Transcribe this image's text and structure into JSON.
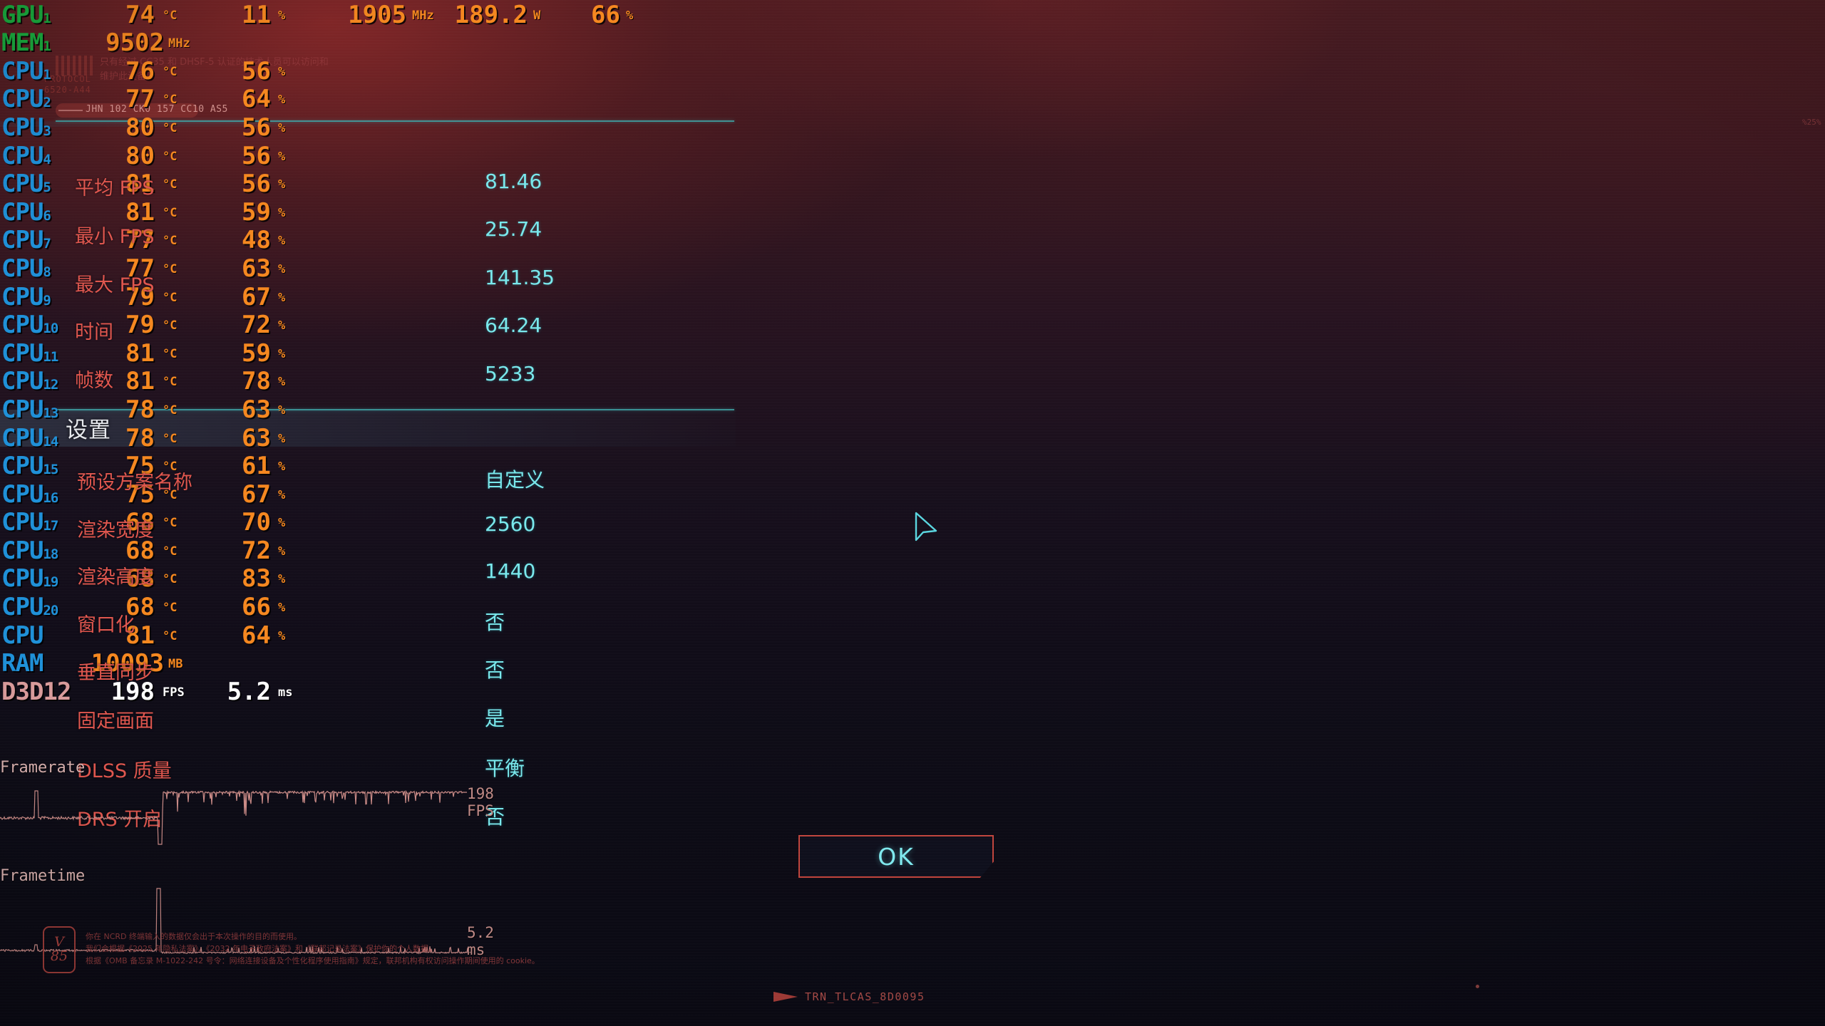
{
  "hud": {
    "rows": [
      {
        "label": "GPU",
        "sub": "1",
        "label_kind": "gpu",
        "cells": [
          {
            "value": "74",
            "unit": "°C",
            "col": "c1"
          },
          {
            "value": "11",
            "unit": "%",
            "col": "c2"
          },
          {
            "value": "1905",
            "unit": "MHz",
            "col": "c3"
          },
          {
            "value": "189.2",
            "unit": "W",
            "col": "c4"
          },
          {
            "value": "66",
            "unit": "%",
            "col": "c5"
          }
        ]
      },
      {
        "label": "MEM",
        "sub": "1",
        "label_kind": "mem",
        "cells": [
          {
            "value": "9502",
            "unit": "MHz",
            "col": "mem"
          }
        ]
      },
      {
        "label": "CPU",
        "sub": "1",
        "label_kind": "cpu",
        "cells": [
          {
            "value": "76",
            "unit": "°C",
            "col": "c1"
          },
          {
            "value": "56",
            "unit": "%",
            "col": "c2"
          }
        ]
      },
      {
        "label": "CPU",
        "sub": "2",
        "label_kind": "cpu",
        "cells": [
          {
            "value": "77",
            "unit": "°C",
            "col": "c1"
          },
          {
            "value": "64",
            "unit": "%",
            "col": "c2"
          }
        ]
      },
      {
        "label": "CPU",
        "sub": "3",
        "label_kind": "cpu",
        "cells": [
          {
            "value": "80",
            "unit": "°C",
            "col": "c1"
          },
          {
            "value": "56",
            "unit": "%",
            "col": "c2"
          }
        ]
      },
      {
        "label": "CPU",
        "sub": "4",
        "label_kind": "cpu",
        "cells": [
          {
            "value": "80",
            "unit": "°C",
            "col": "c1"
          },
          {
            "value": "56",
            "unit": "%",
            "col": "c2"
          }
        ]
      },
      {
        "label": "CPU",
        "sub": "5",
        "label_kind": "cpu",
        "cells": [
          {
            "value": "81",
            "unit": "°C",
            "col": "c1"
          },
          {
            "value": "56",
            "unit": "%",
            "col": "c2"
          }
        ]
      },
      {
        "label": "CPU",
        "sub": "6",
        "label_kind": "cpu",
        "cells": [
          {
            "value": "81",
            "unit": "°C",
            "col": "c1"
          },
          {
            "value": "59",
            "unit": "%",
            "col": "c2"
          }
        ]
      },
      {
        "label": "CPU",
        "sub": "7",
        "label_kind": "cpu",
        "cells": [
          {
            "value": "77",
            "unit": "°C",
            "col": "c1"
          },
          {
            "value": "48",
            "unit": "%",
            "col": "c2"
          }
        ]
      },
      {
        "label": "CPU",
        "sub": "8",
        "label_kind": "cpu",
        "cells": [
          {
            "value": "77",
            "unit": "°C",
            "col": "c1"
          },
          {
            "value": "63",
            "unit": "%",
            "col": "c2"
          }
        ]
      },
      {
        "label": "CPU",
        "sub": "9",
        "label_kind": "cpu",
        "cells": [
          {
            "value": "79",
            "unit": "°C",
            "col": "c1"
          },
          {
            "value": "67",
            "unit": "%",
            "col": "c2"
          }
        ]
      },
      {
        "label": "CPU",
        "sub": "10",
        "label_kind": "cpu",
        "cells": [
          {
            "value": "79",
            "unit": "°C",
            "col": "c1"
          },
          {
            "value": "72",
            "unit": "%",
            "col": "c2"
          }
        ]
      },
      {
        "label": "CPU",
        "sub": "11",
        "label_kind": "cpu",
        "cells": [
          {
            "value": "81",
            "unit": "°C",
            "col": "c1"
          },
          {
            "value": "59",
            "unit": "%",
            "col": "c2"
          }
        ]
      },
      {
        "label": "CPU",
        "sub": "12",
        "label_kind": "cpu",
        "cells": [
          {
            "value": "81",
            "unit": "°C",
            "col": "c1"
          },
          {
            "value": "78",
            "unit": "%",
            "col": "c2"
          }
        ]
      },
      {
        "label": "CPU",
        "sub": "13",
        "label_kind": "cpu",
        "cells": [
          {
            "value": "78",
            "unit": "°C",
            "col": "c1"
          },
          {
            "value": "63",
            "unit": "%",
            "col": "c2"
          }
        ]
      },
      {
        "label": "CPU",
        "sub": "14",
        "label_kind": "cpu",
        "cells": [
          {
            "value": "78",
            "unit": "°C",
            "col": "c1"
          },
          {
            "value": "63",
            "unit": "%",
            "col": "c2"
          }
        ]
      },
      {
        "label": "CPU",
        "sub": "15",
        "label_kind": "cpu",
        "cells": [
          {
            "value": "75",
            "unit": "°C",
            "col": "c1"
          },
          {
            "value": "61",
            "unit": "%",
            "col": "c2"
          }
        ]
      },
      {
        "label": "CPU",
        "sub": "16",
        "label_kind": "cpu",
        "cells": [
          {
            "value": "75",
            "unit": "°C",
            "col": "c1"
          },
          {
            "value": "67",
            "unit": "%",
            "col": "c2"
          }
        ]
      },
      {
        "label": "CPU",
        "sub": "17",
        "label_kind": "cpu",
        "cells": [
          {
            "value": "68",
            "unit": "°C",
            "col": "c1"
          },
          {
            "value": "70",
            "unit": "%",
            "col": "c2"
          }
        ]
      },
      {
        "label": "CPU",
        "sub": "18",
        "label_kind": "cpu",
        "cells": [
          {
            "value": "68",
            "unit": "°C",
            "col": "c1"
          },
          {
            "value": "72",
            "unit": "%",
            "col": "c2"
          }
        ]
      },
      {
        "label": "CPU",
        "sub": "19",
        "label_kind": "cpu",
        "cells": [
          {
            "value": "68",
            "unit": "°C",
            "col": "c1"
          },
          {
            "value": "83",
            "unit": "%",
            "col": "c2"
          }
        ]
      },
      {
        "label": "CPU",
        "sub": "20",
        "label_kind": "cpu",
        "cells": [
          {
            "value": "68",
            "unit": "°C",
            "col": "c1"
          },
          {
            "value": "66",
            "unit": "%",
            "col": "c2"
          }
        ]
      },
      {
        "label": "CPU",
        "sub": "",
        "label_kind": "cpu",
        "cells": [
          {
            "value": "81",
            "unit": "°C",
            "col": "c1"
          },
          {
            "value": "64",
            "unit": "%",
            "col": "c2"
          }
        ]
      },
      {
        "label": "RAM",
        "sub": "",
        "label_kind": "ram",
        "cells": [
          {
            "value": "10093",
            "unit": "MB",
            "col": "mem"
          }
        ]
      },
      {
        "label": "D3D12",
        "sub": "",
        "label_kind": "api",
        "cells": [
          {
            "value": "198",
            "unit": "FPS",
            "col": "c1",
            "white": true
          },
          {
            "value": "5.2",
            "unit": "ms",
            "col": "c2",
            "white": true
          }
        ]
      }
    ]
  },
  "graphs": {
    "framerate_title": "Framerate",
    "framerate_readout": "198 FPS",
    "frametime_title": "Frametime",
    "frametime_readout": "5.2 ms"
  },
  "benchmark": {
    "labels": [
      "平均 FPS",
      "最小 FPS",
      "最大 FPS",
      "时间",
      "帧数"
    ],
    "values": [
      "81.46",
      "25.74",
      "141.35",
      "64.24",
      "5233"
    ]
  },
  "settings": {
    "title": "设置",
    "labels": [
      "预设方案名称",
      "渲染宽度",
      "渲染高度",
      "窗口化",
      "垂直同步",
      "固定画面",
      "DLSS 质量",
      "DRS 开启"
    ],
    "values": [
      "自定义",
      "2560",
      "1440",
      "否",
      "否",
      "是",
      "平衡",
      "否"
    ],
    "ok_label": "OK"
  },
  "decor": {
    "barcode_protocol": "PROTOCOL",
    "barcode_code": "6520-A44",
    "warning_text": "只有经过 CC35 和 DHSF-5 认证的技术人员可以访问和维护此设备。",
    "pill_code": "JHN 102 CK0 157 CC10 AS5",
    "right_mark": "%25%",
    "bottom_tag": "TRN_TLCAS_8D0095"
  },
  "legal": {
    "badge_line1": "V",
    "badge_line2": "85",
    "line1": "你在 NCRD 终端输入的数据仅会出于本次操作的目的而使用。",
    "line2": "我们会根据《2025 年隐私法案》、《2032 年电子政府法案》和《联邦记录法案》保护你的个人数据。",
    "line3": "根据《OMB 备忘录 M-1022-242 号令：网络连接设备及个性化程序使用指南》规定，联邦机构有权访问操作期间使用的 cookie。"
  },
  "colors": {
    "hud_green": "#18a83c",
    "hud_blue": "#1e90d8",
    "hud_orange": "#f5871f",
    "hud_white": "#ffffff",
    "accent_cyan": "#79e8ec",
    "accent_red": "#e0564e",
    "divider": "#3fa6a8"
  }
}
